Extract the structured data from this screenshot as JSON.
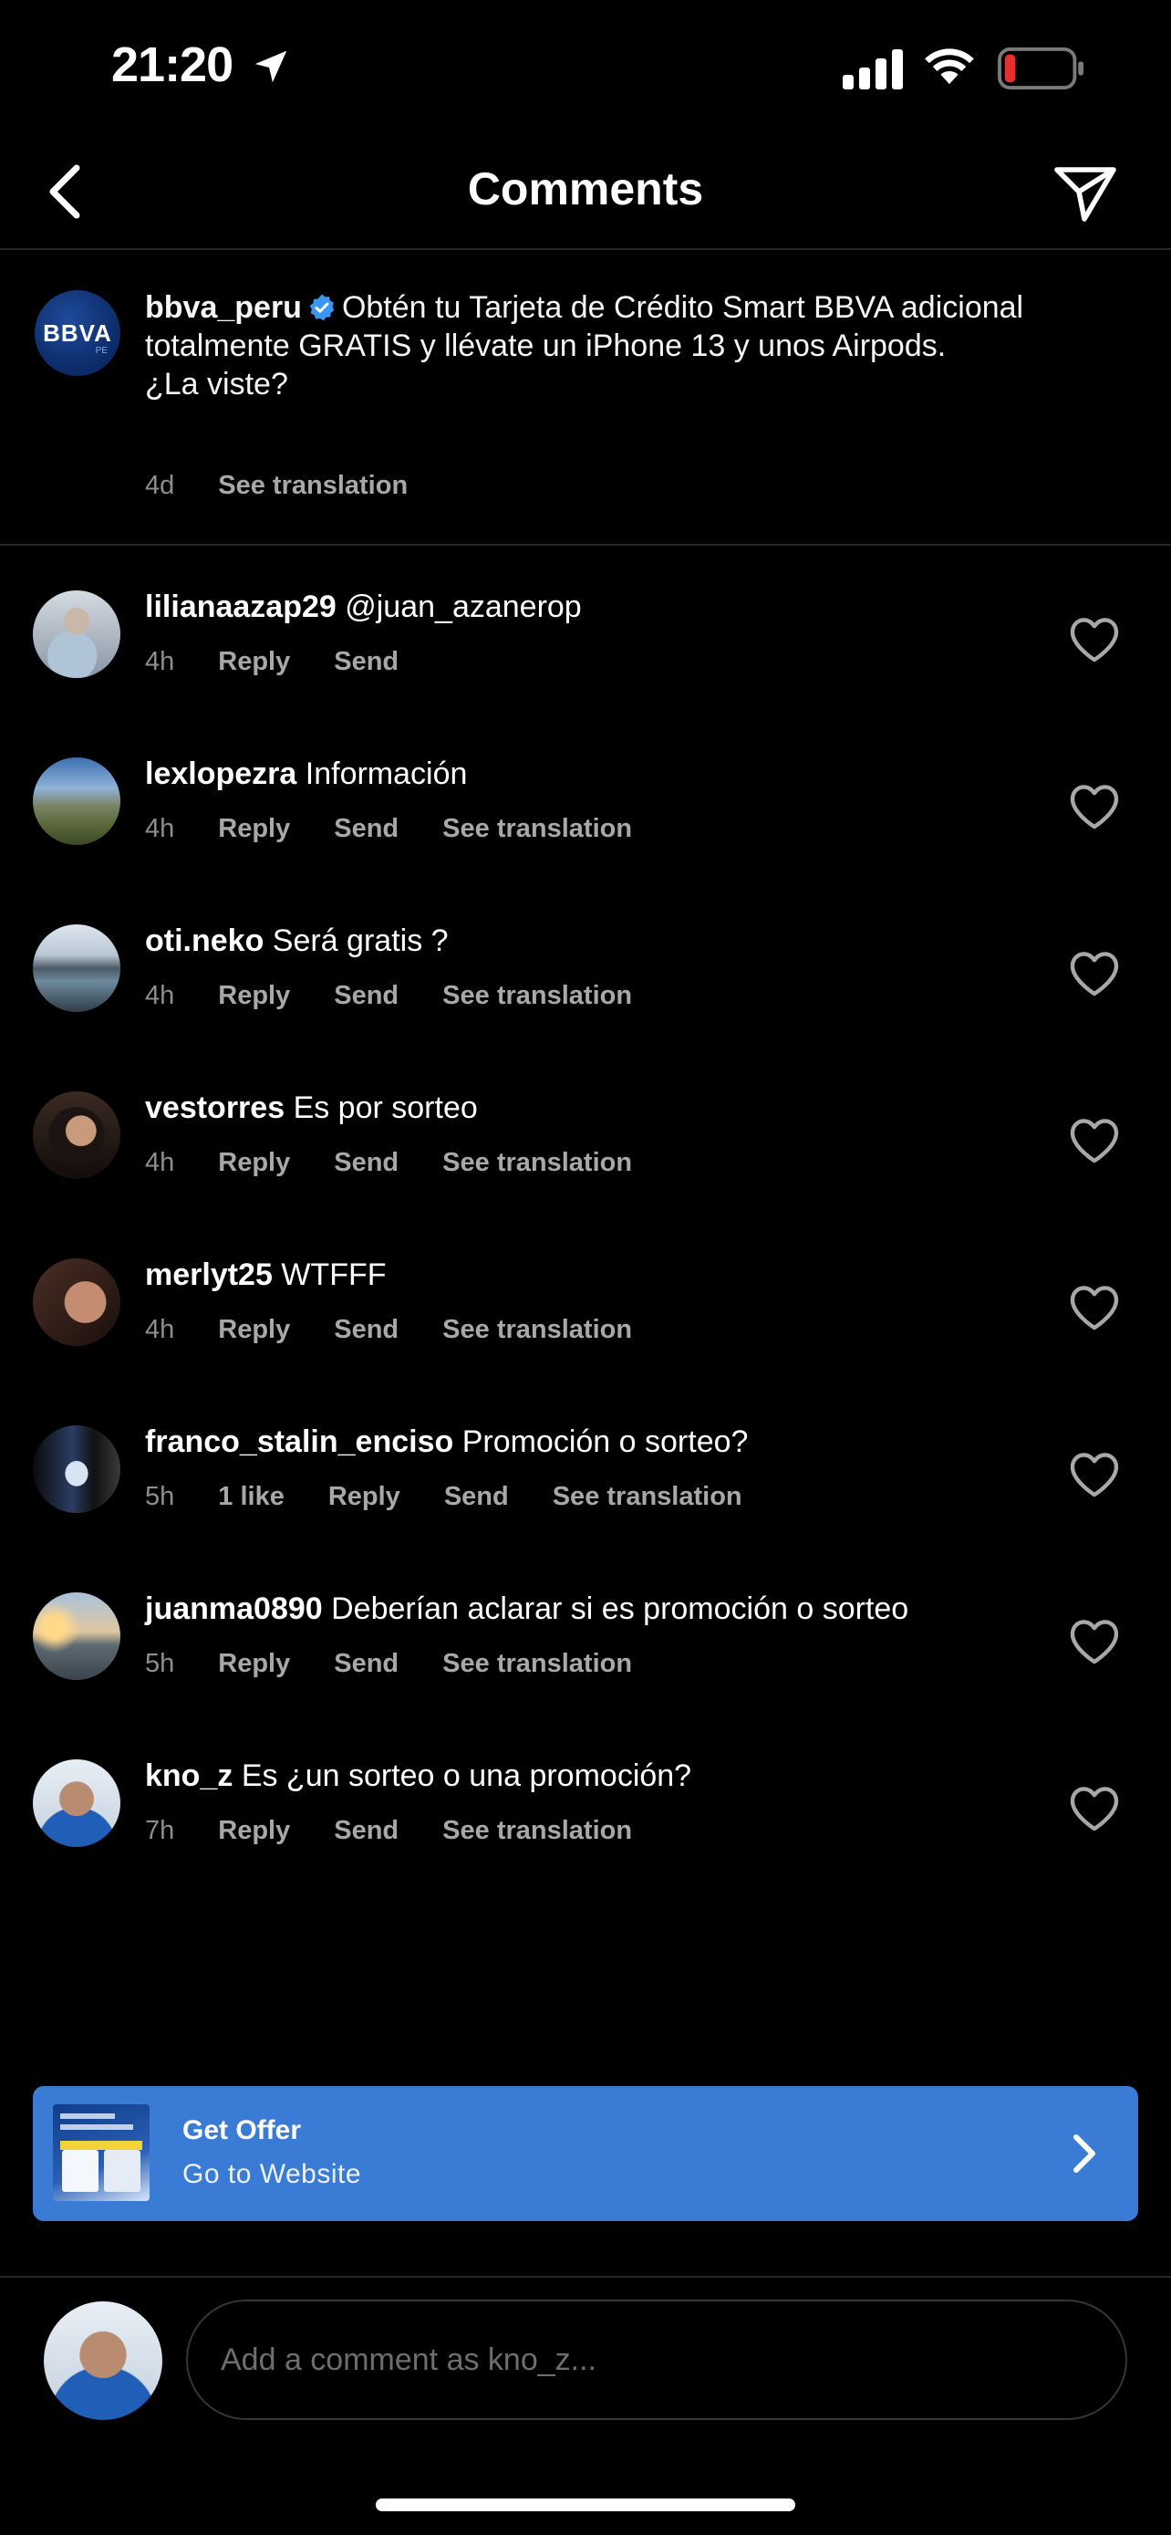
{
  "status_bar": {
    "time": "21:20",
    "icons": [
      "location-arrow-icon",
      "cellular-signal-icon",
      "wifi-icon",
      "battery-low-icon"
    ],
    "battery_color": "#e5302f"
  },
  "header": {
    "title": "Comments",
    "back_icon": "chevron-left-icon",
    "share_icon": "paper-plane-icon"
  },
  "caption": {
    "avatar_text": "BBVA",
    "avatar_sub": "PE",
    "username": "bbva_peru",
    "verified": true,
    "text": "Obtén tu Tarjeta de Crédito  Smart BBVA adicional totalmente GRATIS y llévate un iPhone 13 y unos Airpods.",
    "text_line2": "¿La viste?",
    "time": "4d",
    "see_translation": "See translation"
  },
  "comments": [
    {
      "username": "lilianaazap29",
      "text": "@juan_azanerop",
      "time": "4h",
      "likes": "",
      "reply": "Reply",
      "send": "Send",
      "translation": ""
    },
    {
      "username": "lexlopezra",
      "text": "Información",
      "time": "4h",
      "likes": "",
      "reply": "Reply",
      "send": "Send",
      "translation": "See translation"
    },
    {
      "username": "oti.neko",
      "text": "Será gratis ?",
      "time": "4h",
      "likes": "",
      "reply": "Reply",
      "send": "Send",
      "translation": "See translation"
    },
    {
      "username": "vestorres",
      "text": "Es por sorteo",
      "time": "4h",
      "likes": "",
      "reply": "Reply",
      "send": "Send",
      "translation": "See translation"
    },
    {
      "username": "merlyt25",
      "text": "WTFFF",
      "time": "4h",
      "likes": "",
      "reply": "Reply",
      "send": "Send",
      "translation": "See translation"
    },
    {
      "username": "franco_stalin_enciso",
      "text": "Promoción o sorteo?",
      "time": "5h",
      "likes": "1 like",
      "reply": "Reply",
      "send": "Send",
      "translation": "See translation"
    },
    {
      "username": "juanma0890",
      "text": "Deberían aclarar si es promoción o sorteo",
      "time": "5h",
      "likes": "",
      "reply": "Reply",
      "send": "Send",
      "translation": "See translation"
    },
    {
      "username": "kno_z",
      "text": "Es ¿un sorteo o una promoción?",
      "time": "7h",
      "likes": "",
      "reply": "Reply",
      "send": "Send",
      "translation": "See translation"
    }
  ],
  "offer": {
    "title": "Get Offer",
    "subtitle": "Go to Website",
    "background": "#3a7bd5",
    "icon": "chevron-right-icon"
  },
  "composer": {
    "placeholder": "Add a comment as kno_z..."
  }
}
